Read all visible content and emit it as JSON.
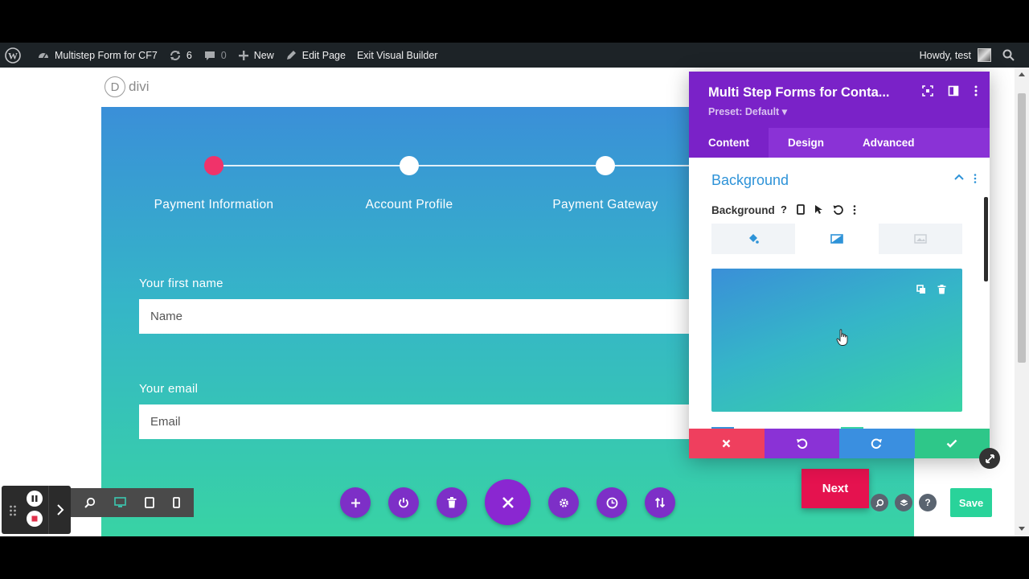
{
  "admin_bar": {
    "site_name": "Multistep Form for CF7",
    "updates_count": "6",
    "comments_count": "0",
    "new_label": "New",
    "edit_page_label": "Edit Page",
    "exit_builder_label": "Exit Visual Builder",
    "howdy_label": "Howdy, test"
  },
  "logo": {
    "text": "divi",
    "mark": "D"
  },
  "form": {
    "steps": [
      {
        "label": "Payment Information",
        "active": true
      },
      {
        "label": "Account Profile",
        "active": false
      },
      {
        "label": "Payment Gateway",
        "active": false
      }
    ],
    "first_name": {
      "label": "Your first name",
      "placeholder": "Name"
    },
    "email": {
      "label": "Your email",
      "placeholder": "Email"
    },
    "next_label": "Next"
  },
  "modal": {
    "title": "Multi Step Forms for Conta...",
    "preset": "Preset: Default ▾",
    "tabs": [
      "Content",
      "Design",
      "Advanced"
    ],
    "active_tab": "Content",
    "group_title": "Background",
    "option_label": "Background",
    "help_glyph": "?"
  },
  "toolbar": {
    "save_label": "Save",
    "help_glyph": "?"
  },
  "colors": {
    "purple": "#7a22c8",
    "accent_blue": "#2e93d8",
    "pink": "#f0336a",
    "next_red": "#e5124f",
    "save_green": "#29d39a",
    "footer_red": "#ef3f5e",
    "footer_purple": "#8a32d6",
    "footer_blue": "#3a8fe0",
    "footer_green": "#2ec789"
  }
}
